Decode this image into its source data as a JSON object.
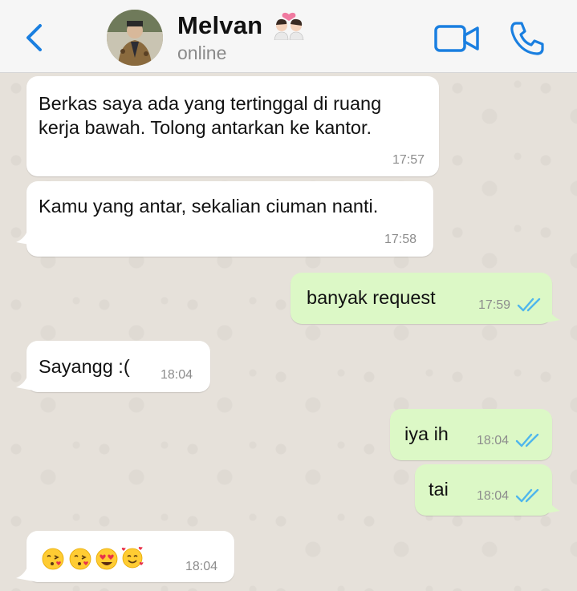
{
  "header": {
    "back_icon": "chevron-left-icon",
    "contact_name": "Melvan",
    "name_emoji": "kiss-couple-emoji",
    "status": "online",
    "video_icon": "video-camera-icon",
    "phone_icon": "phone-icon",
    "accent_color": "#1a7fe0"
  },
  "messages": [
    {
      "direction": "incoming",
      "lines": [
        "Berkas saya ada yang tertinggal di ruang",
        "kerja bawah. Tolong antarkan ke kantor."
      ],
      "time": "17:57"
    },
    {
      "direction": "incoming",
      "lines": [
        "Kamu yang antar, sekalian ciuman nanti."
      ],
      "time": "17:58"
    },
    {
      "direction": "outgoing",
      "text": "banyak request",
      "time": "17:59",
      "read": true
    },
    {
      "direction": "incoming",
      "text": "Sayangg :(",
      "time": "18:04"
    },
    {
      "direction": "outgoing",
      "text": "iya ih",
      "time": "18:04",
      "read": true
    },
    {
      "direction": "outgoing",
      "text": "tai",
      "time": "18:04",
      "read": true
    },
    {
      "direction": "incoming",
      "emojis": [
        "face-blowing-kiss",
        "face-blowing-kiss",
        "heart-eyes-face",
        "smiling-face-with-hearts"
      ],
      "time": "18:04"
    }
  ],
  "colors": {
    "incoming_bubble": "#ffffff",
    "outgoing_bubble": "#dcf8c6",
    "read_ticks": "#4fb6ec",
    "chat_background": "#e6e1da"
  }
}
